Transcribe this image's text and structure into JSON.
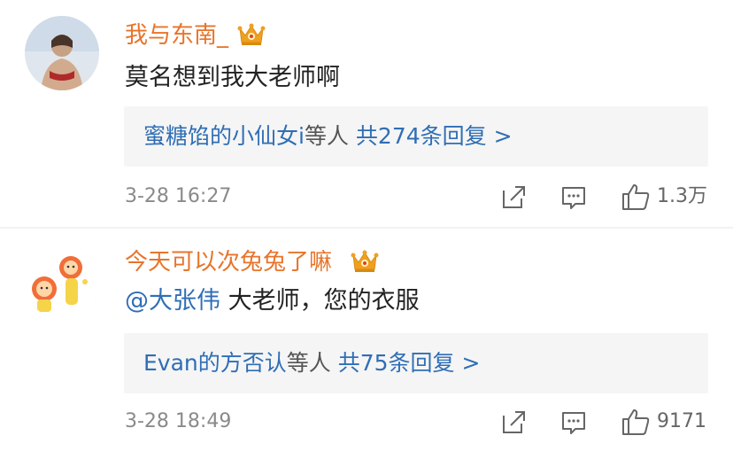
{
  "comments": [
    {
      "username": "我与东南_",
      "content": "莫名想到我大老师啊",
      "mention": "",
      "reply_names": "蜜糖馅的小仙女i",
      "reply_suffix": "等人",
      "reply_count": "共274条回复 >",
      "time": "3-28 16:27",
      "likes": "1.3万"
    },
    {
      "username": "今天可以次兔兔了嘛",
      "content": "大老师，您的衣服",
      "mention": "@大张伟",
      "reply_names": "Evan的方否认",
      "reply_suffix": "等人",
      "reply_count": "共75条回复 >",
      "time": "3-28 18:49",
      "likes": "9171"
    }
  ],
  "icons": {
    "crown": "crown-icon",
    "share": "share-icon",
    "comment": "comment-icon",
    "like": "thumbs-up-icon"
  },
  "colors": {
    "username": "#e8742a",
    "link": "#2f6eb5",
    "reply_bg": "#f5f5f5",
    "meta": "#8a8a8a",
    "crown": "#f0a020"
  }
}
